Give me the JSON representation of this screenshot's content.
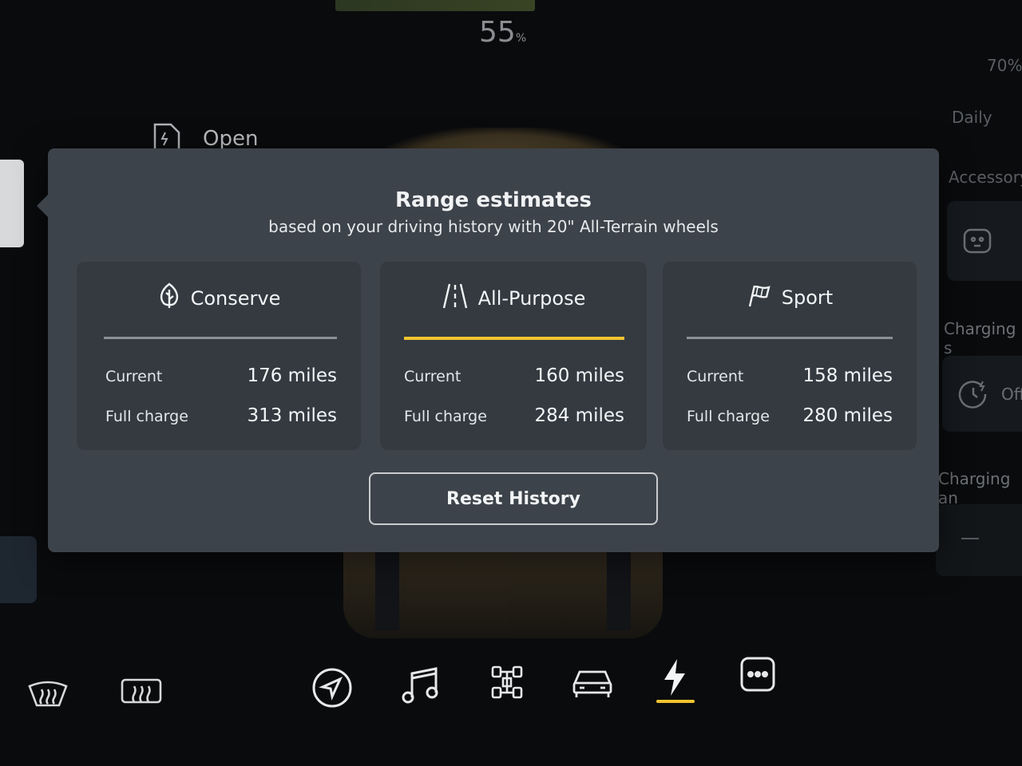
{
  "status": {
    "battery_percent": "55",
    "battery_unit": "%"
  },
  "left_panel": {
    "open_label": "Open"
  },
  "side_panel": {
    "item1": "70%",
    "item2": "Daily",
    "item3": "Accessory",
    "item4": "Charging s",
    "item5": "Off",
    "item6": "Charging an"
  },
  "modal": {
    "title": "Range estimates",
    "subtitle": "based on your driving history with 20\" All-Terrain wheels",
    "modes": [
      {
        "name": "Conserve",
        "icon": "leaf-icon",
        "active": false,
        "current_label": "Current",
        "current_value": "176 miles",
        "full_label": "Full charge",
        "full_value": "313 miles"
      },
      {
        "name": "All-Purpose",
        "icon": "road-icon",
        "active": true,
        "current_label": "Current",
        "current_value": "160 miles",
        "full_label": "Full charge",
        "full_value": "284 miles"
      },
      {
        "name": "Sport",
        "icon": "flag-icon",
        "active": false,
        "current_label": "Current",
        "current_value": "158 miles",
        "full_label": "Full charge",
        "full_value": "280 miles"
      }
    ],
    "reset_label": "Reset History"
  },
  "nav": {
    "items": [
      "front-defrost-icon",
      "rear-defrost-icon",
      "navigation-icon",
      "music-icon",
      "drivetrain-icon",
      "vehicle-icon",
      "charging-icon",
      "more-icon"
    ],
    "active": "charging-icon"
  },
  "colors": {
    "accent": "#f4c430",
    "modal_bg": "#3d434a",
    "card_bg": "#343a40"
  }
}
